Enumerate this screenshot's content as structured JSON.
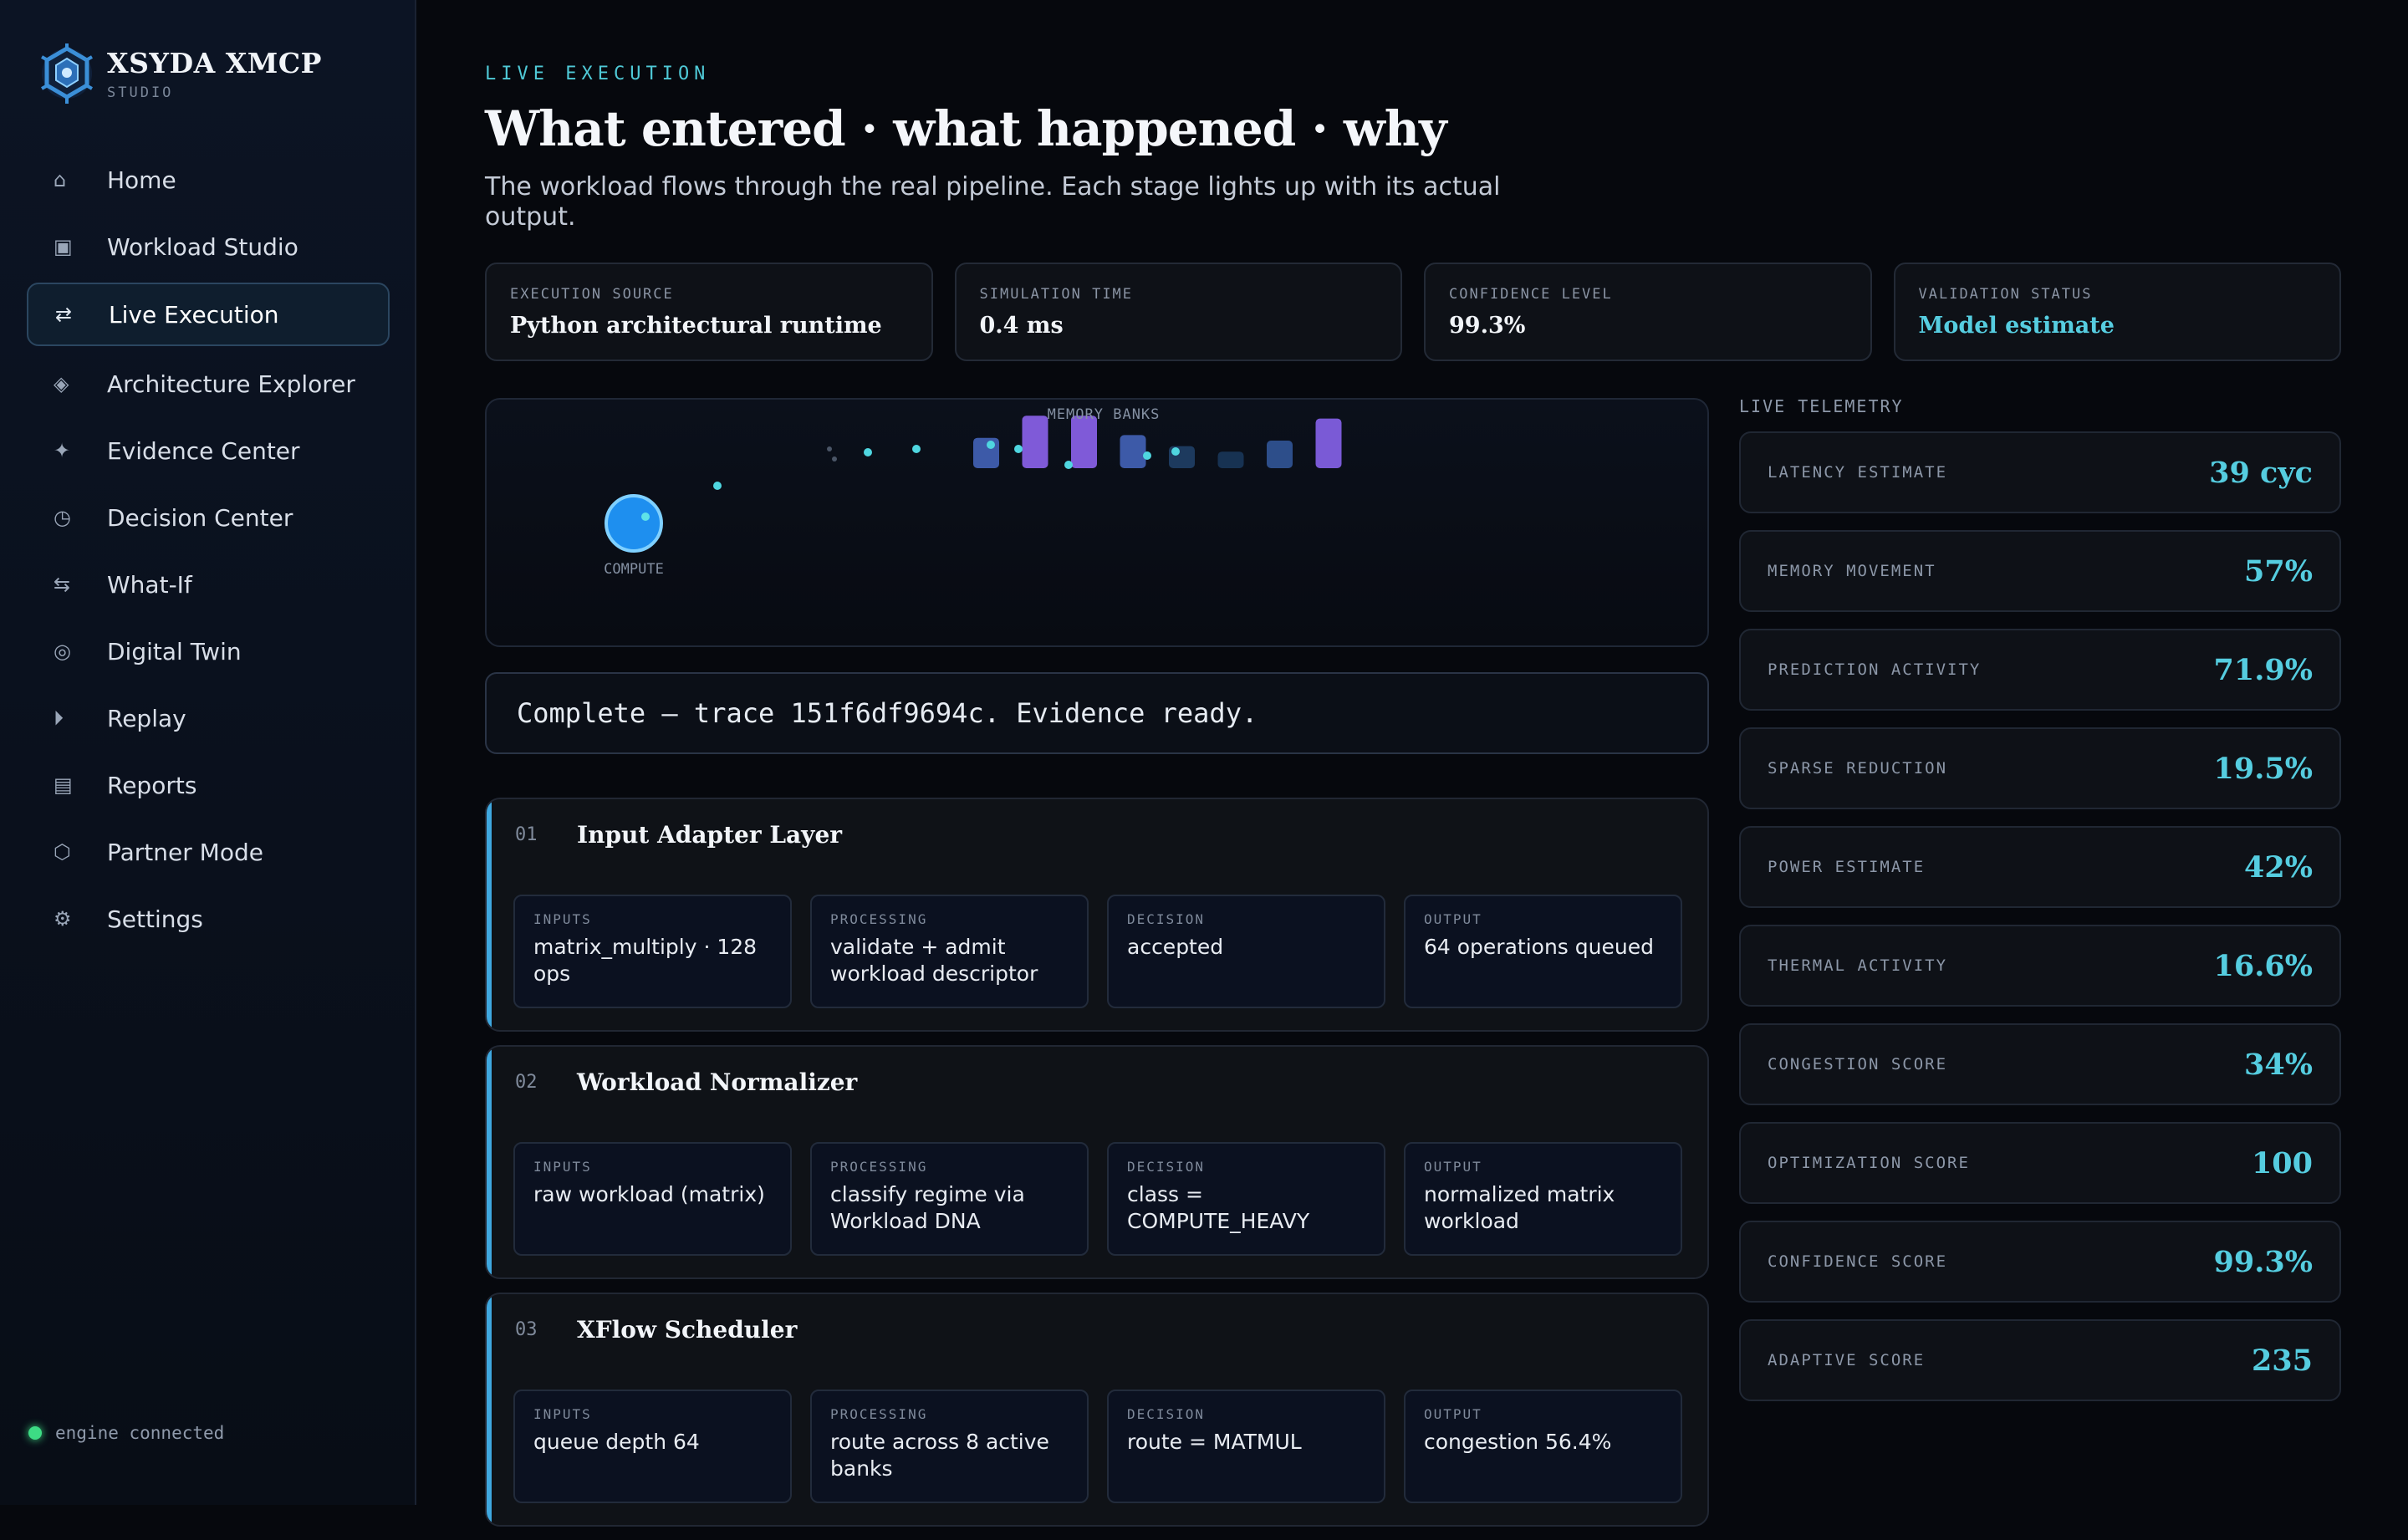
{
  "brand": {
    "name": "XSYDA XMCP",
    "sub": "STUDIO"
  },
  "nav": [
    {
      "icon": "⌂",
      "icon_name": "home-icon",
      "label": "Home",
      "active": false
    },
    {
      "icon": "▣",
      "icon_name": "studio-icon",
      "label": "Workload Studio",
      "active": false
    },
    {
      "icon": "⇄",
      "icon_name": "exchange-icon",
      "label": "Live Execution",
      "active": true
    },
    {
      "icon": "◈",
      "icon_name": "diamond-icon",
      "label": "Architecture Explorer",
      "active": false
    },
    {
      "icon": "✦",
      "icon_name": "sparkle-icon",
      "label": "Evidence Center",
      "active": false
    },
    {
      "icon": "◷",
      "icon_name": "clock-icon",
      "label": "Decision Center",
      "active": false
    },
    {
      "icon": "⇆",
      "icon_name": "swap-icon",
      "label": "What-If",
      "active": false
    },
    {
      "icon": "◎",
      "icon_name": "twin-icon",
      "label": "Digital Twin",
      "active": false
    },
    {
      "icon": "⏵",
      "icon_name": "play-icon",
      "label": "Replay",
      "active": false
    },
    {
      "icon": "▤",
      "icon_name": "report-icon",
      "label": "Reports",
      "active": false
    },
    {
      "icon": "⬡",
      "icon_name": "hexagon-icon",
      "label": "Partner Mode",
      "active": false
    },
    {
      "icon": "⚙",
      "icon_name": "gear-icon",
      "label": "Settings",
      "active": false
    }
  ],
  "engine": {
    "label": "engine connected",
    "color": "#3ddc84"
  },
  "header": {
    "eyebrow": "LIVE EXECUTION",
    "title": "What entered · what happened · why",
    "subtitle": "The workload flows through the real pipeline. Each stage lights up with its actual output."
  },
  "kpis": [
    {
      "label": "EXECUTION SOURCE",
      "value": "Python architectural runtime",
      "accent": false
    },
    {
      "label": "SIMULATION TIME",
      "value": "0.4 ms",
      "accent": false
    },
    {
      "label": "CONFIDENCE LEVEL",
      "value": "99.3%",
      "accent": false
    },
    {
      "label": "VALIDATION STATUS",
      "value": "Model estimate",
      "accent": true
    }
  ],
  "viz": {
    "memory_label": "MEMORY BANKS",
    "compute_label": "COMPUTE",
    "bank_levels": [
      0.55,
      0.95,
      0.95,
      0.6,
      0.4,
      0.3,
      0.5,
      0.9
    ],
    "bank_colors": [
      "#3d5aa8",
      "#7f5ad8",
      "#7f5ad8",
      "#3d5aa8",
      "#1d3a5e",
      "#173252",
      "#2d4e8a",
      "#7a5ad6"
    ]
  },
  "trace": "Complete — trace 151f6df9694c. Evidence ready.",
  "stages": [
    {
      "num": "01",
      "title": "Input Adapter Layer",
      "cells": [
        {
          "label": "INPUTS",
          "value": "matrix_multiply · 128 ops"
        },
        {
          "label": "PROCESSING",
          "value": "validate + admit workload descriptor"
        },
        {
          "label": "DECISION",
          "value": "accepted"
        },
        {
          "label": "OUTPUT",
          "value": "64 operations queued"
        }
      ]
    },
    {
      "num": "02",
      "title": "Workload Normalizer",
      "cells": [
        {
          "label": "INPUTS",
          "value": "raw workload (matrix)"
        },
        {
          "label": "PROCESSING",
          "value": "classify regime via Workload DNA"
        },
        {
          "label": "DECISION",
          "value": "class = COMPUTE_HEAVY"
        },
        {
          "label": "OUTPUT",
          "value": "normalized matrix workload"
        }
      ]
    },
    {
      "num": "03",
      "title": "XFlow Scheduler",
      "cells": [
        {
          "label": "INPUTS",
          "value": "queue depth 64"
        },
        {
          "label": "PROCESSING",
          "value": "route across 8 active banks"
        },
        {
          "label": "DECISION",
          "value": "route = MATMUL"
        },
        {
          "label": "OUTPUT",
          "value": "congestion 56.4%"
        }
      ]
    }
  ],
  "telemetry": {
    "title": "LIVE TELEMETRY",
    "items": [
      {
        "label": "LATENCY ESTIMATE",
        "value": "39 cyc"
      },
      {
        "label": "MEMORY MOVEMENT",
        "value": "57%"
      },
      {
        "label": "PREDICTION ACTIVITY",
        "value": "71.9%"
      },
      {
        "label": "SPARSE REDUCTION",
        "value": "19.5%"
      },
      {
        "label": "POWER ESTIMATE",
        "value": "42%"
      },
      {
        "label": "THERMAL ACTIVITY",
        "value": "16.6%"
      },
      {
        "label": "CONGESTION SCORE",
        "value": "34%"
      },
      {
        "label": "OPTIMIZATION SCORE",
        "value": "100"
      },
      {
        "label": "CONFIDENCE SCORE",
        "value": "99.3%"
      },
      {
        "label": "ADAPTIVE SCORE",
        "value": "235"
      }
    ]
  }
}
